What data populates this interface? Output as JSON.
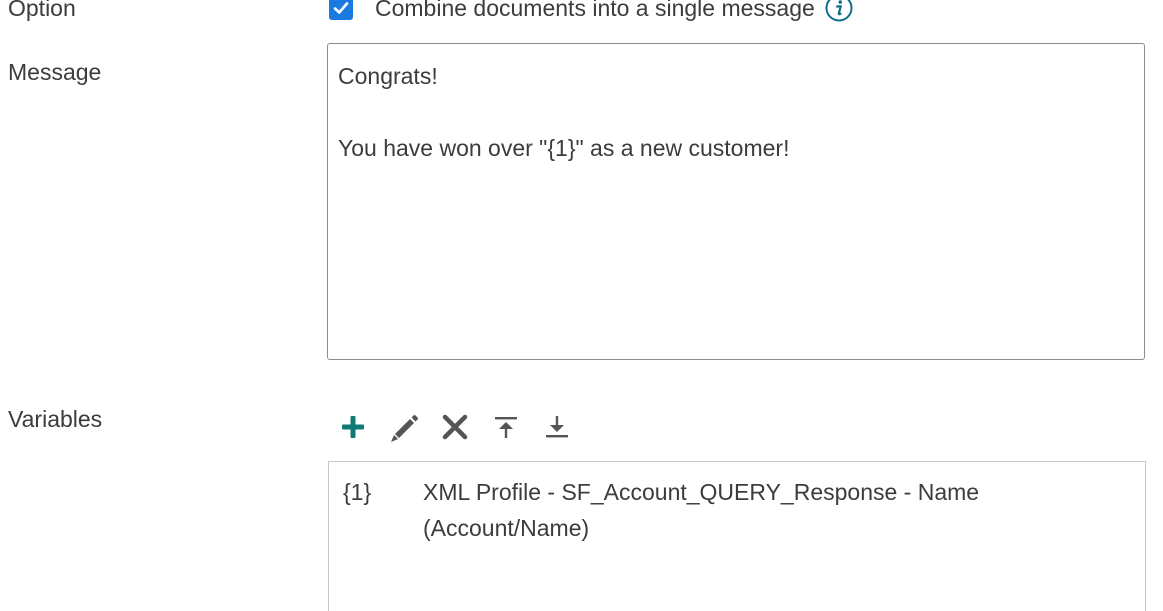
{
  "option": {
    "label": "Option",
    "checkbox_checked": true,
    "checkbox_text": "Combine documents into a single message",
    "info_icon": "info-icon",
    "accent_color": "#1a7ae0"
  },
  "message": {
    "label": "Message",
    "value": "Congrats!\n\nYou have won over \"{1}\" as a new customer!"
  },
  "variables": {
    "label": "Variables",
    "toolbar": {
      "add_icon": "plus-icon",
      "edit_icon": "pencil-icon",
      "delete_icon": "x-icon",
      "move_top_icon": "arrow-up-to-top-icon",
      "move_bottom_icon": "arrow-down-to-bottom-icon",
      "add_color": "#0f7a76"
    },
    "rows": [
      {
        "key": "{1}",
        "value": "XML Profile - SF_Account_QUERY_Response - Name (Account/Name)"
      }
    ]
  }
}
